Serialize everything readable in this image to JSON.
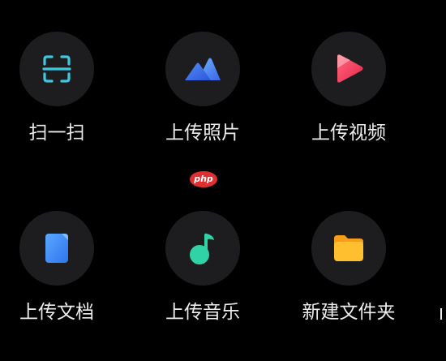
{
  "actions": {
    "scan": {
      "label": "扫一扫",
      "icon": "scan-icon"
    },
    "upload_photo": {
      "label": "上传照片",
      "icon": "mountain-photo-icon"
    },
    "upload_video": {
      "label": "上传视频",
      "icon": "play-video-icon"
    },
    "upload_document": {
      "label": "上传文档",
      "icon": "document-icon"
    },
    "upload_music": {
      "label": "上传音乐",
      "icon": "music-note-icon"
    },
    "new_folder": {
      "label": "新建文件夹",
      "icon": "folder-icon"
    }
  },
  "watermark": {
    "text": "php"
  },
  "colors": {
    "background": "#000000",
    "tile_circle": "#1d1d1f",
    "label_text": "#ececec",
    "scan_accent": "#3ec8e0",
    "photo_accent": "#3f7cf5",
    "video_accent": "#f4425f",
    "document_accent": "#3a8ef6",
    "music_accent": "#2fd3a6",
    "folder_accent": "#ffb52a"
  }
}
